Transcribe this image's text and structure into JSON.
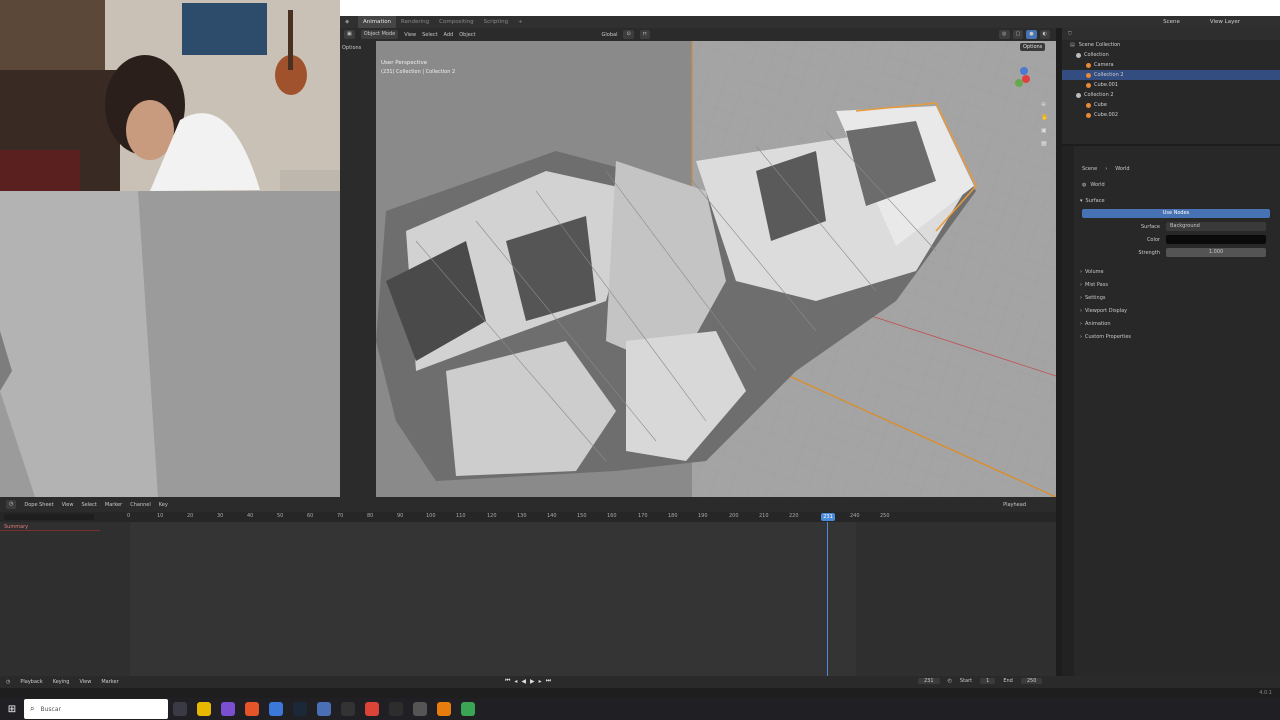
{
  "workspace_tabs": [
    {
      "label": "Animation",
      "active": true
    },
    {
      "label": "Rendering",
      "active": false
    },
    {
      "label": "Compositing",
      "active": false
    },
    {
      "label": "Scripting",
      "active": false
    },
    {
      "label": "+",
      "active": false
    }
  ],
  "topbar_right": {
    "scene": "Scene",
    "view_layer": "View Layer"
  },
  "viewport": {
    "mode": "Object Mode",
    "menus": [
      "View",
      "Select",
      "Add",
      "Object"
    ],
    "transform": "Global",
    "options": "Options",
    "overlay_title": "User Perspective",
    "overlay_sub": "(231) Collection | Collection 2",
    "left_options": "Options"
  },
  "outliner": {
    "title": "Scene Collection",
    "items": [
      {
        "label": "Collection",
        "indent": 1
      },
      {
        "label": "Camera",
        "indent": 2
      },
      {
        "label": "Collection 2",
        "indent": 2,
        "selected": true
      },
      {
        "label": "Cube.001",
        "indent": 2
      },
      {
        "label": "Collection 2",
        "indent": 1
      },
      {
        "label": "Cube",
        "indent": 2
      },
      {
        "label": "Cube.002",
        "indent": 2
      }
    ]
  },
  "properties": {
    "breadcrumb": [
      "Scene",
      "World"
    ],
    "world_name": "World",
    "surface_section": "Surface",
    "use_nodes": "Use Nodes",
    "surface_label": "Surface",
    "surface_value": "Background",
    "color_label": "Color",
    "strength_label": "Strength",
    "strength_value": "1.000",
    "sections": [
      "Volume",
      "Mist Pass",
      "Settings",
      "Viewport Display",
      "Animation",
      "Custom Properties"
    ]
  },
  "dopesheet": {
    "editor": "Dope Sheet",
    "menus": [
      "View",
      "Select",
      "Marker",
      "Channel",
      "Key"
    ],
    "summary": "Summary",
    "playhead_mode": "Playhead",
    "current_frame": "231",
    "ticks": [
      "0",
      "10",
      "20",
      "30",
      "40",
      "50",
      "60",
      "70",
      "80",
      "90",
      "100",
      "110",
      "120",
      "130",
      "140",
      "150",
      "160",
      "170",
      "180",
      "190",
      "200",
      "210",
      "220",
      "240",
      "250"
    ]
  },
  "playback": {
    "menus": [
      "Playback",
      "Keying",
      "View",
      "Marker"
    ],
    "frame": "231",
    "start_label": "Start",
    "start": "1",
    "end_label": "End",
    "end": "250"
  },
  "statusbar": {
    "version": "4.0.1"
  },
  "taskbar": {
    "search_placeholder": "Buscar"
  }
}
